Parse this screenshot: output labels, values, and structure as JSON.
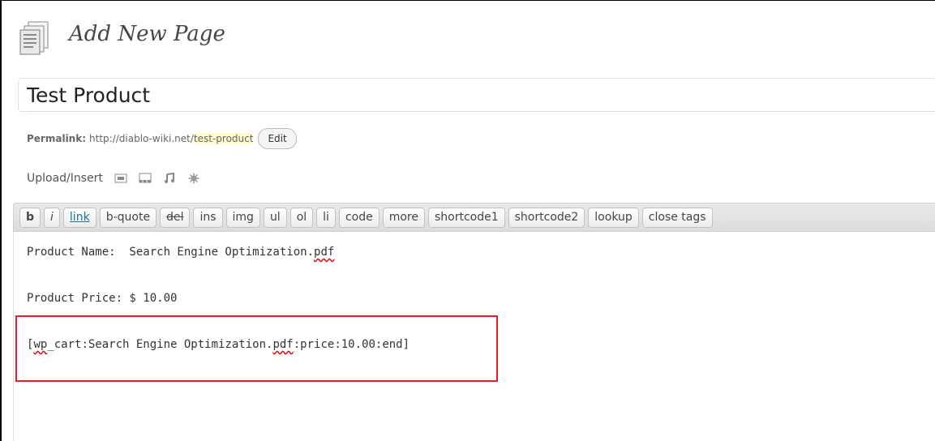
{
  "header": {
    "title": "Add New Page",
    "icon": "page-icon"
  },
  "title_field": {
    "value": "Test Product"
  },
  "permalink": {
    "label": "Permalink:",
    "base_url": "http://diablo-wiki.net/",
    "slug": "test-product",
    "edit_label": "Edit"
  },
  "upload": {
    "label": "Upload/Insert",
    "icons": [
      "add-image-icon",
      "add-video-icon",
      "add-audio-icon",
      "add-media-icon"
    ]
  },
  "quicktags": [
    "b",
    "i",
    "link",
    "b-quote",
    "del",
    "ins",
    "img",
    "ul",
    "ol",
    "li",
    "code",
    "more",
    "shortcode1",
    "shortcode2",
    "lookup",
    "close tags"
  ],
  "content": {
    "line1_prefix": "Product Name:  Search Engine Optimization.",
    "line1_pdf": "pdf",
    "line2": "Product Price: $ 10.00",
    "line3_open": "[",
    "line3_wp": "wp",
    "line3_mid": "_cart:Search Engine Optimization.",
    "line3_pdf": "pdf",
    "line3_end": ":price:10.00:end]"
  },
  "colors": {
    "highlight_border": "#e0202a",
    "link": "#21759b",
    "slug_highlight": "#fffbcc"
  }
}
